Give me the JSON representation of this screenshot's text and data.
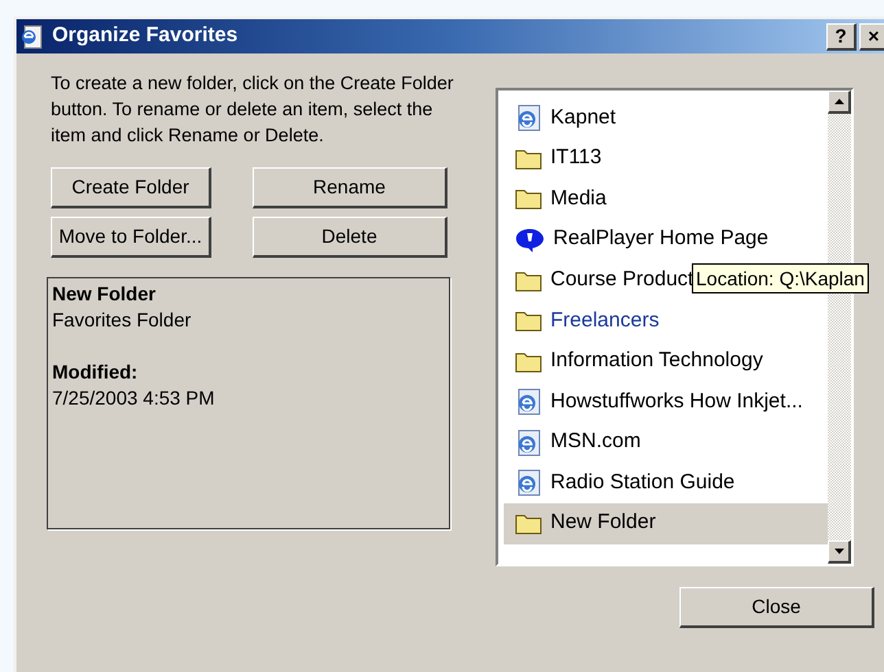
{
  "window": {
    "title": "Organize Favorites",
    "title_buttons": [
      "?",
      "×"
    ]
  },
  "instructions": "To create a new folder, click on the Create Folder button. To rename or delete an item, select the item and click Rename or Delete.",
  "buttons": [
    "Create Folder",
    "Rename",
    "Move to Folder...",
    "Delete"
  ],
  "details": {
    "name": "New Folder",
    "type": "Favorites Folder",
    "modified_label": "Modified:",
    "modified": "7/25/2003 4:53 PM"
  },
  "favorites": [
    {
      "kind": "web",
      "label": "Kapnet",
      "selected": false,
      "hot": false
    },
    {
      "kind": "folder",
      "label": "IT113",
      "selected": false,
      "hot": false
    },
    {
      "kind": "folder",
      "label": "Media",
      "selected": false,
      "hot": false
    },
    {
      "kind": "player",
      "label": "RealPlayer Home Page",
      "selected": false,
      "hot": false
    },
    {
      "kind": "folder",
      "label": "Course Product",
      "selected": false,
      "hot": false
    },
    {
      "kind": "folder",
      "label": "Freelancers",
      "selected": false,
      "hot": true
    },
    {
      "kind": "folder",
      "label": "Information Technology",
      "selected": false,
      "hot": false
    },
    {
      "kind": "web",
      "label": "Howstuffworks How Inkjet...",
      "selected": false,
      "hot": false
    },
    {
      "kind": "web",
      "label": "MSN.com",
      "selected": false,
      "hot": false
    },
    {
      "kind": "web",
      "label": "Radio Station Guide",
      "selected": false,
      "hot": false
    },
    {
      "kind": "folder",
      "label": "New Folder",
      "selected": true,
      "hot": false
    }
  ],
  "tooltip": "Location: Q:\\Kaplan",
  "close_button": "Close"
}
